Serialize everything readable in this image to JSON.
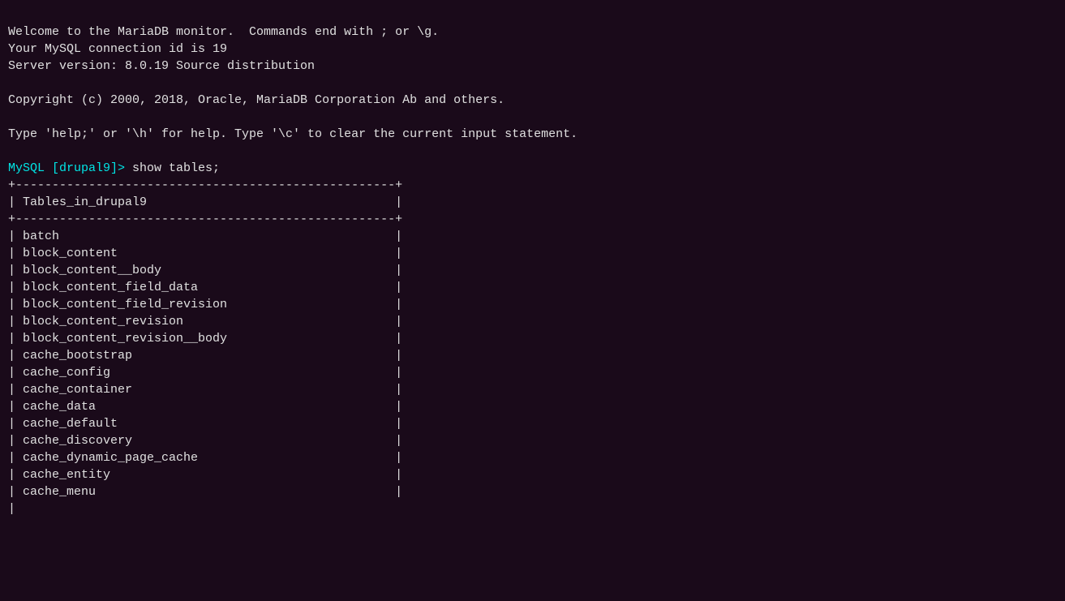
{
  "terminal": {
    "welcome_line1": "Welcome to the MariaDB monitor.  Commands end with ; or \\g.",
    "welcome_line2": "Your MySQL connection id is 19",
    "welcome_line3": "Server version: 8.0.19 Source distribution",
    "blank1": "",
    "copyright": "Copyright (c) 2000, 2018, Oracle, MariaDB Corporation Ab and others.",
    "blank2": "",
    "help_text": "Type 'help;' or '\\h' for help. Type '\\c' to clear the current input statement.",
    "blank3": "",
    "prompt": "MySQL [drupal9]> show tables;",
    "table_top_border": "+----------------------------------------------------+",
    "table_header": "| Tables_in_drupal9                                  |",
    "table_mid_border": "+----------------------------------------------------+",
    "tables": [
      "batch",
      "block_content",
      "block_content__body",
      "block_content_field_data",
      "block_content_field_revision",
      "block_content_revision",
      "block_content_revision__body",
      "cache_bootstrap",
      "cache_config",
      "cache_container",
      "cache_data",
      "cache_default",
      "cache_discovery",
      "cache_dynamic_page_cache",
      "cache_entity",
      "cache_menu"
    ]
  }
}
